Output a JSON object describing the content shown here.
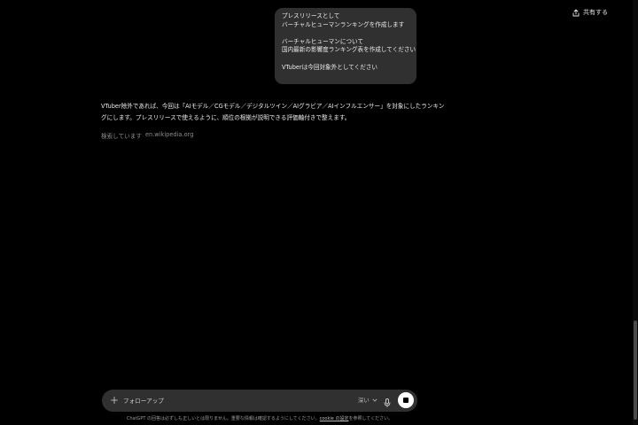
{
  "header": {
    "share_label": "共有する"
  },
  "user_message": {
    "lines": [
      "プレスリリースとして",
      "バーチャルヒューマンランキングを作成します",
      "",
      "バーチャルヒューマンについて",
      "国内最新の影響度ランキング表を作成してください",
      "",
      "VTuberは今回対象外としてください"
    ]
  },
  "assistant_reply": {
    "lines": [
      "VTuber除外であれば、今回は「AIモデル／CGモデル／デジタルツイン／AIグラビア／AIインフルエンサー」を対象にしたランキン",
      "グにします。プレスリリースで使えるように、順位の根拠が説明できる評価軸付きで整えます。"
    ]
  },
  "status": {
    "searching_label": "検索しています",
    "searching_site": "en.wikipedia.org"
  },
  "composer": {
    "placeholder": "フォローアップ",
    "depth_label": "深い",
    "plus_icon": "plus-icon",
    "mic_icon": "mic-icon",
    "stop_icon": "stop-icon"
  },
  "footer": {
    "text": "ChatGPT の回答は必ずしも正しいとは限りません。重要な情報は確認するようにしてください。",
    "link": "cookie の設定",
    "suffix": "を参照してください。"
  },
  "colors": {
    "background": "#000000",
    "bubble": "#303030",
    "composer": "#303030",
    "text": "#ececec",
    "muted": "#8c8c8c"
  }
}
